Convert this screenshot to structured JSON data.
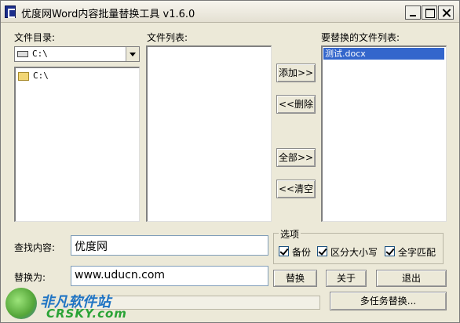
{
  "window": {
    "title": "优度网Word内容批量替换工具 v1.6.0"
  },
  "labels": {
    "dir": "文件目录:",
    "files": "文件列表:",
    "replace_files": "要替换的文件列表:",
    "find": "查找内容:",
    "replace": "替换为:",
    "options": "选项"
  },
  "drive_combo": {
    "value": "C:\\",
    "icon": "drive-icon"
  },
  "dir_tree": {
    "items": [
      {
        "label": "C:\\",
        "icon": "folder-icon"
      }
    ]
  },
  "file_list": {
    "items": []
  },
  "replace_list": {
    "items": [
      "测试.docx"
    ]
  },
  "buttons": {
    "add": "添加>>",
    "remove": "<<删除",
    "all": "全部>>",
    "clear": "<<清空",
    "replace": "替换",
    "about": "关于",
    "exit": "退出",
    "multi": "多任务替换..."
  },
  "inputs": {
    "find_value": "优度网",
    "replace_value": "www.uducn.com"
  },
  "options": {
    "backup": {
      "label": "备份",
      "checked": true
    },
    "case": {
      "label": "区分大小写",
      "checked": true
    },
    "whole": {
      "label": "全字匹配",
      "checked": true
    }
  },
  "watermark": {
    "text_cn": "非凡软件站",
    "text_en": "CRSKY.com"
  },
  "colors": {
    "selection": "#3366cc",
    "window_bg": "#ece9d8"
  }
}
